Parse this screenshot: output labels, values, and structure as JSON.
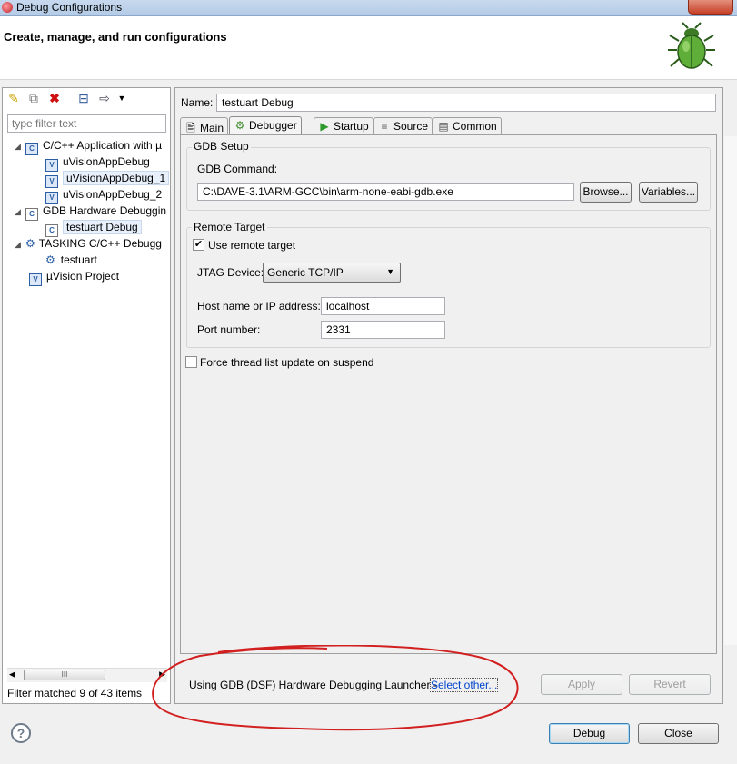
{
  "window": {
    "title": "Debug Configurations"
  },
  "header": {
    "title": "Create, manage, and run configurations"
  },
  "toolbar": {
    "icons": [
      "new-config-icon",
      "duplicate-icon",
      "delete-icon",
      "collapse-all-icon",
      "filter-icon",
      "dropdown-icon"
    ]
  },
  "filter": {
    "placeholder": "type filter text"
  },
  "tree": {
    "items": [
      {
        "label": "C/C++ Application with µ",
        "level": 0,
        "expanded": true,
        "icon": "cpp-app-icon"
      },
      {
        "label": "uVisionAppDebug",
        "level": 1,
        "icon": "uvision-icon"
      },
      {
        "label": "uVisionAppDebug_1",
        "level": 1,
        "icon": "uvision-icon"
      },
      {
        "label": "uVisionAppDebug_2",
        "level": 1,
        "icon": "uvision-icon"
      },
      {
        "label": "GDB Hardware Debuggin",
        "level": 0,
        "expanded": true,
        "icon": "c-config-icon"
      },
      {
        "label": "testuart Debug",
        "level": 1,
        "selected": true,
        "icon": "c-config-icon"
      },
      {
        "label": "TASKING C/C++ Debugg",
        "level": 0,
        "expanded": true,
        "icon": "tasking-icon"
      },
      {
        "label": "testuart",
        "level": 1,
        "icon": "tasking-icon"
      },
      {
        "label": "µVision Project",
        "level": 0,
        "icon": "uvision-icon"
      }
    ],
    "scroll_grip": "III"
  },
  "filter_status": "Filter matched 9 of 43 items",
  "config": {
    "name_label": "Name:",
    "name_value": "testuart Debug",
    "tabs": [
      {
        "label": "Main",
        "icon": "main-tab-icon"
      },
      {
        "label": "Debugger",
        "icon": "debugger-tab-icon",
        "active": true
      },
      {
        "label": "Startup",
        "icon": "startup-tab-icon"
      },
      {
        "label": "Source",
        "icon": "source-tab-icon"
      },
      {
        "label": "Common",
        "icon": "common-tab-icon"
      }
    ],
    "gdb_setup": {
      "group_label": "GDB Setup",
      "command_label": "GDB Command:",
      "command_value": "C:\\DAVE-3.1\\ARM-GCC\\bin\\arm-none-eabi-gdb.exe",
      "browse_label": "Browse...",
      "variables_label": "Variables..."
    },
    "remote_target": {
      "group_label": "Remote Target",
      "use_remote_label": "Use remote target",
      "use_remote_checked": true,
      "jtag_label": "JTAG Device:",
      "jtag_value": "Generic TCP/IP",
      "host_label": "Host name or IP address:",
      "host_value": "localhost",
      "port_label": "Port number:",
      "port_value": "2331"
    },
    "force_thread_label": "Force thread list update on suspend",
    "force_thread_checked": false
  },
  "footer": {
    "launcher_text": "Using GDB (DSF) Hardware Debugging Launcher - ",
    "select_other": "Select other...",
    "apply_label": "Apply",
    "revert_label": "Revert",
    "debug_label": "Debug",
    "close_label": "Close"
  },
  "colors": {
    "annotation": "#d22020",
    "link": "#0044cc"
  }
}
